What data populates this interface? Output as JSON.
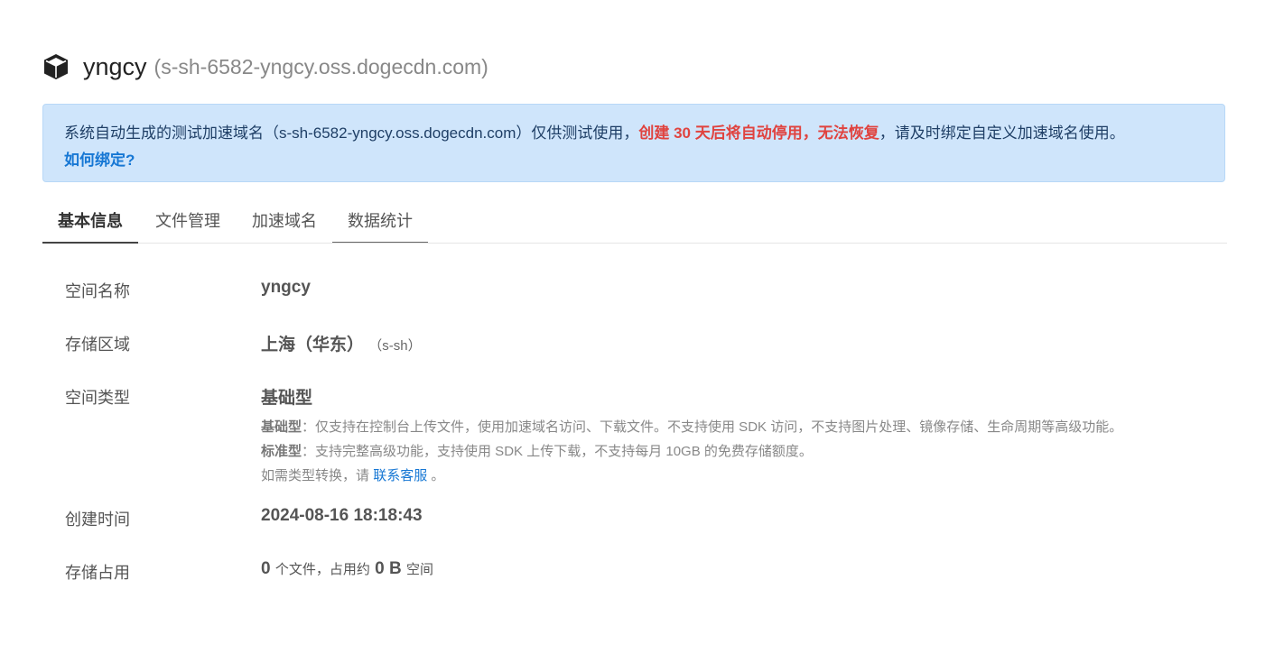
{
  "header": {
    "bucket_name": "yngcy",
    "bucket_domain": "(s-sh-6582-yngcy.oss.dogecdn.com)",
    "icon": "cube-icon"
  },
  "alert": {
    "text_before": "系统自动生成的测试加速域名（s-sh-6582-yngcy.oss.dogecdn.com）仅供测试使用，",
    "warning": "创建 30 天后将自动停用，无法恢复",
    "text_after": "，请及时绑定自定义加速域名使用。",
    "link": "如何绑定?",
    "colors": {
      "background": "#cfe5fb",
      "warning": "#e0433f",
      "link": "#1677d4"
    }
  },
  "tabs": [
    {
      "label": "基本信息",
      "active": true
    },
    {
      "label": "文件管理",
      "active": false
    },
    {
      "label": "加速域名",
      "active": false
    },
    {
      "label": "数据统计",
      "active": false
    }
  ],
  "info": {
    "name": {
      "label": "空间名称",
      "value": "yngcy"
    },
    "region": {
      "label": "存储区域",
      "value": "上海（华东）",
      "code": "（s-sh）"
    },
    "type": {
      "label": "空间类型",
      "value": "基础型",
      "basic_title": "基础型",
      "basic_desc": "：仅支持在控制台上传文件，使用加速域名访问、下载文件。不支持使用 SDK 访问，不支持图片处理、镜像存储、生命周期等高级功能。",
      "standard_title": "标准型",
      "standard_desc": "：支持完整高级功能，支持使用 SDK 上传下载，不支持每月 10GB 的免费存储额度。",
      "convert_text": "如需类型转换，请",
      "convert_link": "联系客服",
      "convert_end": "。"
    },
    "created": {
      "label": "创建时间",
      "value": "2024-08-16 18:18:43"
    },
    "usage": {
      "label": "存储占用",
      "file_count": "0",
      "file_text": "个文件，占用约",
      "size": "0 B",
      "size_text": "空间"
    }
  }
}
